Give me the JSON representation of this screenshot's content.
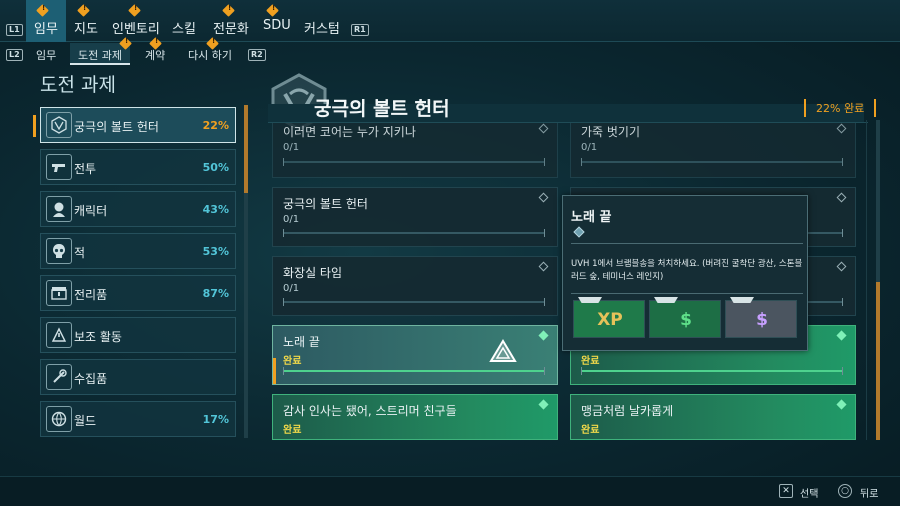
{
  "topnav": {
    "left_hint": "L1",
    "right_hint": "R1",
    "tabs": [
      {
        "label": "임무",
        "active": true
      },
      {
        "label": "지도"
      },
      {
        "label": "인벤토리"
      },
      {
        "label": "스킬"
      },
      {
        "label": "전문화"
      },
      {
        "label": "SDU"
      },
      {
        "label": "커스텀"
      }
    ]
  },
  "subnav": {
    "left_hint": "L2",
    "right_hint": "R2",
    "tabs": [
      {
        "label": "임무"
      },
      {
        "label": "도전 과제",
        "active": true
      },
      {
        "label": "계약"
      },
      {
        "label": "다시 하기"
      }
    ]
  },
  "left_panel": {
    "title": "도전 과제",
    "categories": [
      {
        "name": "궁극의 볼트 헌터",
        "percent": "22%",
        "icon": "vault-emblem-icon"
      },
      {
        "name": "전투",
        "percent": "50%",
        "icon": "pistol-icon"
      },
      {
        "name": "캐릭터",
        "percent": "43%",
        "icon": "character-head-icon"
      },
      {
        "name": "적",
        "percent": "53%",
        "icon": "enemy-skull-icon"
      },
      {
        "name": "전리품",
        "percent": "87%",
        "icon": "loot-chest-icon"
      },
      {
        "name": "보조 활동",
        "percent": "",
        "icon": "side-activity-icon"
      },
      {
        "name": "수집품",
        "percent": "",
        "icon": "collectible-icon"
      },
      {
        "name": "월드",
        "percent": "17%",
        "icon": "world-icon"
      }
    ]
  },
  "header": {
    "title": "궁극의 볼트 헌터",
    "percent": "22% 완료"
  },
  "cards": {
    "c1": {
      "title": "이러면 코어는 누가 지키나",
      "progress": "0/1"
    },
    "c2": {
      "title": "가죽 벗기기",
      "progress": "0/1"
    },
    "c3": {
      "title": "궁극의 볼트 헌터",
      "progress": "0/1"
    },
    "c4": {
      "title": "",
      "progress": ""
    },
    "c5": {
      "title": "화장실 타임",
      "progress": "0/1"
    },
    "c6": {
      "title": "",
      "progress": ""
    },
    "c7": {
      "title": "노래 끝",
      "progress": "완료"
    },
    "c8": {
      "title": "",
      "progress": "완료"
    },
    "c9": {
      "title": "감사 인사는 됐어, 스트리머 친구들",
      "progress": "완료"
    },
    "c10": {
      "title": "맹금처럼 날카롭게",
      "progress": "완료"
    }
  },
  "tooltip": {
    "title": "노래 끝",
    "description": "UVH 1에서 브램블송을 처치하세요. (버려진 굴착단 광산, 스톤블러드 숲, 테미너스 레인지)",
    "rewards": [
      {
        "label": "XP",
        "color": "#e6c25a",
        "bg": "#1f7a4a",
        "icon": "xp-reward-icon"
      },
      {
        "label": "$",
        "color": "#5fe08a",
        "bg": "#1d6e45",
        "icon": "cash-reward-icon"
      },
      {
        "label": "$",
        "color": "#c7a0ff",
        "bg": "#4b5560",
        "icon": "eridium-reward-icon"
      }
    ]
  },
  "bottombar": {
    "select_key": "✕",
    "select_label": "선택",
    "back_key": "○",
    "back_label": "뒤로"
  }
}
